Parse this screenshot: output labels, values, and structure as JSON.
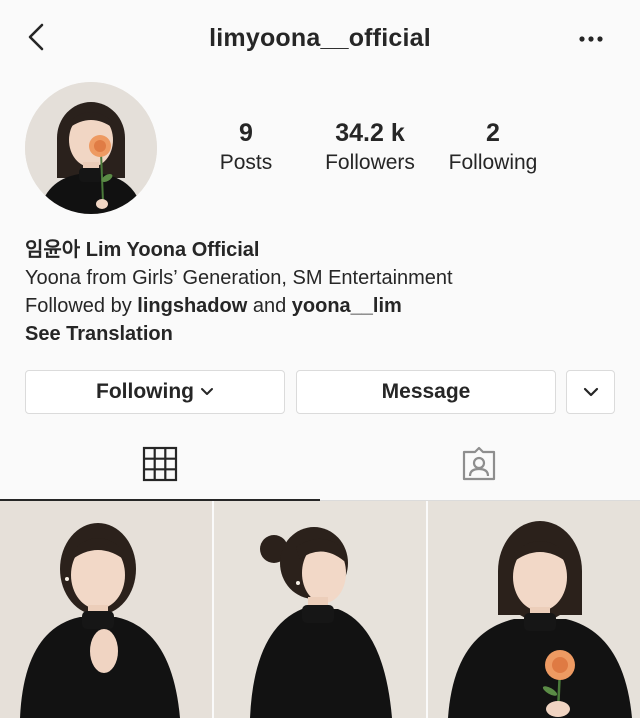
{
  "header": {
    "username": "limyoona__official",
    "back_icon": "chevron-left-icon",
    "more_icon": "more-horizontal-icon"
  },
  "profile": {
    "avatar_icon": "profile-avatar",
    "stats": [
      {
        "value": "9",
        "label": "Posts"
      },
      {
        "value": "34.2 k",
        "label": "Followers"
      },
      {
        "value": "2",
        "label": "Following"
      }
    ]
  },
  "bio": {
    "name": "임윤아 Lim Yoona Official",
    "description": "Yoona from Girls’ Generation, SM Entertainment",
    "followed_prefix": "Followed by ",
    "followed_user1": "lingshadow",
    "followed_and": " and ",
    "followed_user2": "yoona__lim",
    "see_translation": "See Translation"
  },
  "actions": {
    "following_label": "Following",
    "message_label": "Message"
  },
  "tabs": [
    {
      "icon": "grid-icon",
      "active": true
    },
    {
      "icon": "tagged-person-icon",
      "active": false
    }
  ],
  "colors": {
    "background": "#fafafa",
    "text": "#262626",
    "border": "#dbdbdb"
  }
}
